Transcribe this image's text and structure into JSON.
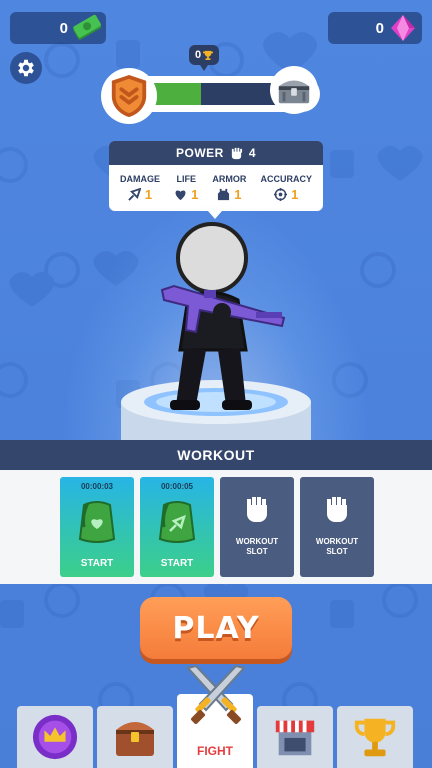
{
  "currency": {
    "cash": {
      "value": "0",
      "icon": "cash-icon",
      "color": "#3fc04a"
    },
    "gems": {
      "value": "0",
      "icon": "gem-icon",
      "color": "#e040c8"
    }
  },
  "progress": {
    "badge": "0",
    "badge_icon": "trophy-icon",
    "fill_fraction": 0.39
  },
  "stats": {
    "title": "POWER",
    "power_value": "4",
    "items": [
      {
        "label": "DAMAGE",
        "value": "1",
        "icon": "damage-icon"
      },
      {
        "label": "LIFE",
        "value": "1",
        "icon": "heart-icon"
      },
      {
        "label": "ARMOR",
        "value": "1",
        "icon": "armor-icon"
      },
      {
        "label": "ACCURACY",
        "value": "1",
        "icon": "crosshair-icon"
      }
    ]
  },
  "workout": {
    "title": "WORKOUT",
    "slots": [
      {
        "time": "00:00:03",
        "action": "START",
        "icon": "bag-heart-icon"
      },
      {
        "time": "00:00:05",
        "action": "START",
        "icon": "bag-damage-icon"
      },
      {
        "label_line1": "WORKOUT",
        "label_line2": "SLOT",
        "icon": "fist-icon"
      },
      {
        "label_line1": "WORKOUT",
        "label_line2": "SLOT",
        "icon": "fist-icon"
      }
    ]
  },
  "play_label": "PLAY",
  "nav": {
    "selected": "FIGHT",
    "items": [
      {
        "icon": "crown-coin-icon"
      },
      {
        "icon": "chest-icon"
      },
      {
        "label": "FIGHT",
        "icon": "crossed-swords-icon"
      },
      {
        "icon": "shop-icon"
      },
      {
        "icon": "trophy-icon"
      }
    ]
  },
  "colors": {
    "accent": "#f57c3a",
    "panel_dark": "#34466c",
    "value_orange": "#f0a020",
    "bg_blue": "#4c82dc",
    "fight_red": "#e43d3d"
  }
}
